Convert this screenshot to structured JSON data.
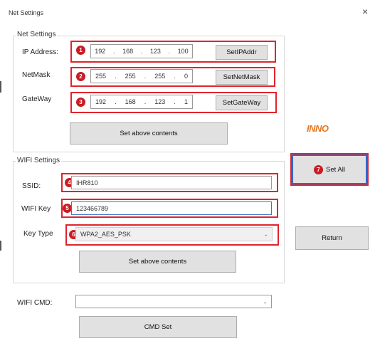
{
  "window": {
    "title": "Net Settings",
    "close_glyph": "×"
  },
  "net_settings": {
    "group_title": "Net Settings",
    "ip": {
      "label": "IP Address:",
      "octets": [
        "192",
        "168",
        "123",
        "100"
      ],
      "button": "SetIPAddr",
      "badge": "1"
    },
    "netmask": {
      "label": "NetMask",
      "octets": [
        "255",
        "255",
        "255",
        "0"
      ],
      "button": "SetNetMask",
      "badge": "2"
    },
    "gateway": {
      "label": "GateWay",
      "octets": [
        "192",
        "168",
        "123",
        "1"
      ],
      "button": "SetGateWay",
      "badge": "3"
    },
    "set_button": "Set above contents"
  },
  "wifi_settings": {
    "group_title": "WIFI Settings",
    "ssid": {
      "label": "SSID:",
      "value": "IHR810",
      "badge": "4"
    },
    "key": {
      "label": "WIFI Key",
      "value": "123466789",
      "badge": "5"
    },
    "key_type": {
      "label": "Key Type",
      "value": "WPA2_AES_PSK",
      "badge": "6"
    },
    "set_button": "Set above contents"
  },
  "wifi_cmd": {
    "label": "WIFI CMD:",
    "value": "",
    "button": "CMD Set"
  },
  "side": {
    "logo": "INNO",
    "logo_sub": "",
    "set_all": {
      "label": "Set All",
      "badge": "7"
    },
    "return_button": "Return"
  },
  "colors": {
    "highlight": "#e0242c",
    "badge": "#c81d25",
    "logo": "#e87722",
    "set_all_border": "#3b63c4"
  }
}
